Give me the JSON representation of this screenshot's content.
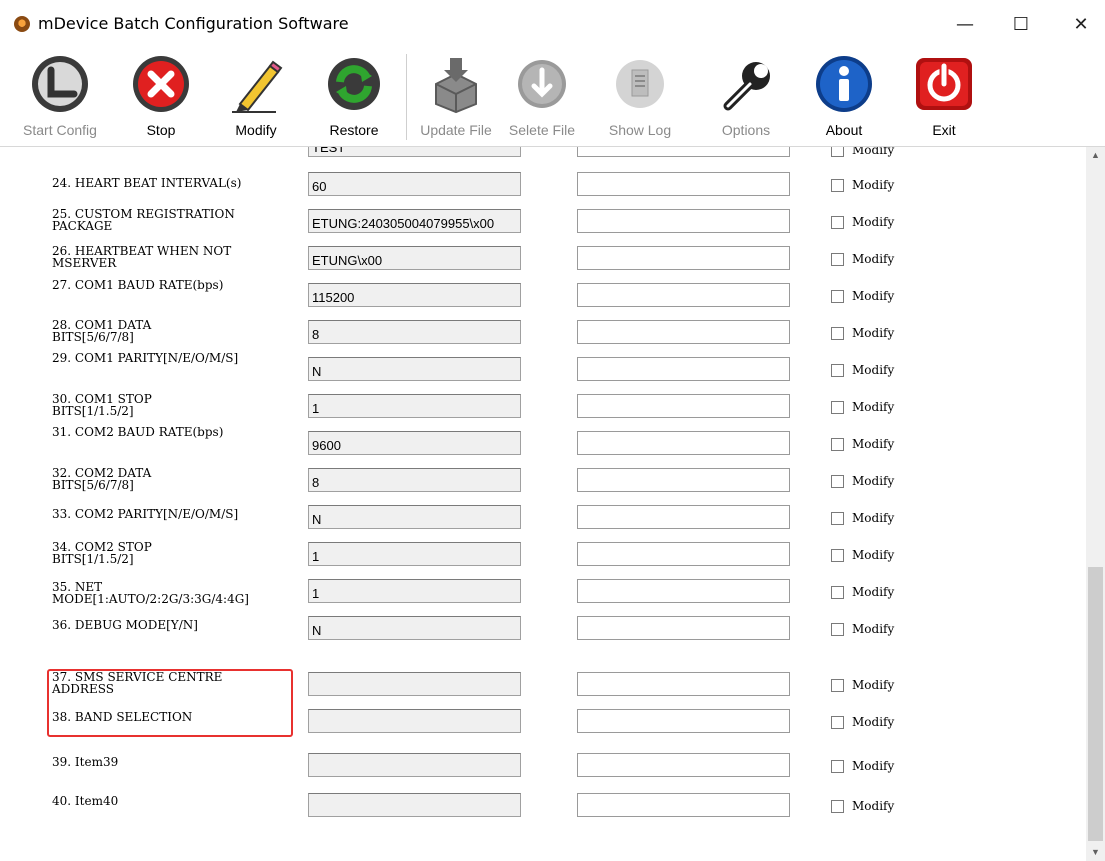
{
  "window": {
    "title": "mDevice Batch Configuration Software",
    "minimize": "—",
    "maximize": "☐",
    "close": "✕"
  },
  "toolbar": {
    "start_config": "Start Config",
    "stop": "Stop",
    "modify": "Modify",
    "restore": "Restore",
    "update_file": "Update File",
    "select_file": "Selete File",
    "show_log": "Show Log",
    "options": "Options",
    "about": "About",
    "exit": "Exit"
  },
  "partial_row": {
    "value": "TEST",
    "modify": "Modify"
  },
  "rows": [
    {
      "label": "24. HEART BEAT INTERVAL(s)",
      "value": "60",
      "modify": "Modify"
    },
    {
      "label": "25. CUSTOM REGISTRATION\nPACKAGE",
      "value": "ETUNG:240305004079955\\x00",
      "modify": "Modify"
    },
    {
      "label": "26. HEARTBEAT WHEN NOT\nMSERVER",
      "value": "ETUNG\\x00",
      "modify": "Modify"
    },
    {
      "label": "27. COM1 BAUD RATE(bps)",
      "value": "115200",
      "modify": "Modify"
    },
    {
      "label": "28. COM1 DATA\nBITS[5/6/7/8]",
      "value": "8",
      "modify": "Modify"
    },
    {
      "label": "29. COM1 PARITY[N/E/O/M/S]",
      "value": "N",
      "modify": "Modify"
    },
    {
      "label": "30. COM1 STOP\nBITS[1/1.5/2]",
      "value": "1",
      "modify": "Modify"
    },
    {
      "label": "31. COM2 BAUD RATE(bps)",
      "value": "9600",
      "modify": "Modify"
    },
    {
      "label": "32. COM2 DATA\nBITS[5/6/7/8]",
      "value": "8",
      "modify": "Modify"
    },
    {
      "label": "33. COM2 PARITY[N/E/O/M/S]",
      "value": "N",
      "modify": "Modify"
    },
    {
      "label": "34. COM2 STOP\nBITS[1/1.5/2]",
      "value": "1",
      "modify": "Modify"
    },
    {
      "label": "35. NET\nMODE[1:AUTO/2:2G/3:3G/4:4G]",
      "value": "1",
      "modify": "Modify"
    },
    {
      "label": "36. DEBUG MODE[Y/N]",
      "value": "N",
      "modify": "Modify"
    },
    {
      "label": "37. SMS SERVICE CENTRE\nADDRESS",
      "value": "",
      "modify": "Modify"
    },
    {
      "label": "38. BAND SELECTION",
      "value": "",
      "modify": "Modify"
    },
    {
      "label": "39. Item39",
      "value": "",
      "modify": "Modify"
    },
    {
      "label": "40. Item40",
      "value": "",
      "modify": "Modify"
    }
  ],
  "colors": {
    "highlight": "#e8312f",
    "stop_red": "#e02020",
    "about_blue": "#1e63c8",
    "restore_green": "#2fa52f"
  }
}
